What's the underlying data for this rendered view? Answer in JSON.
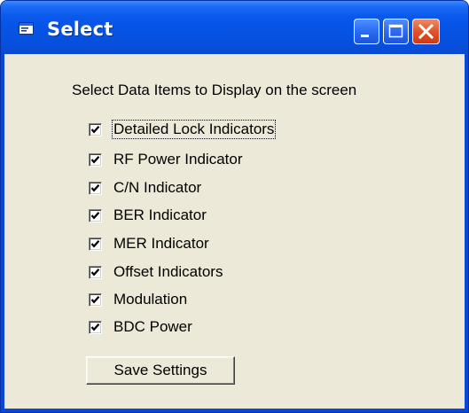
{
  "window": {
    "title": "Select",
    "controls": {
      "minimize_icon": "minimize-icon",
      "maximize_icon": "maximize-icon",
      "close_icon": "close-icon"
    }
  },
  "dialog": {
    "heading": "Select Data Items to Display on the screen",
    "items": [
      {
        "label": "Detailed Lock Indicators",
        "checked": true,
        "focused": true
      },
      {
        "label": "RF Power Indicator",
        "checked": true,
        "focused": false
      },
      {
        "label": "C/N Indicator",
        "checked": true,
        "focused": false
      },
      {
        "label": "BER Indicator",
        "checked": true,
        "focused": false
      },
      {
        "label": "MER Indicator",
        "checked": true,
        "focused": false
      },
      {
        "label": "Offset Indicators",
        "checked": true,
        "focused": false
      },
      {
        "label": "Modulation",
        "checked": true,
        "focused": false
      },
      {
        "label": "BDC Power",
        "checked": true,
        "focused": false
      }
    ],
    "save_label": "Save Settings"
  },
  "colors": {
    "title_bar": "#0653e4",
    "client_background": "#ece9d8",
    "close_button": "#e0542a"
  }
}
